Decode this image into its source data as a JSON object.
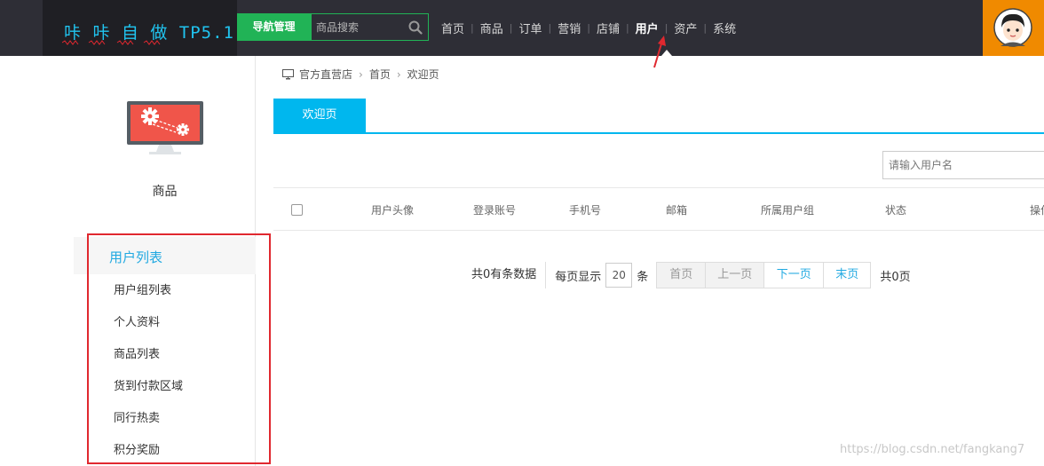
{
  "header": {
    "logo_text": "咔 咔 自 做 TP5.1",
    "nav_manage_label": "导航管理",
    "search_placeholder": "商品搜索",
    "menu": [
      {
        "label": "首页"
      },
      {
        "label": "商品"
      },
      {
        "label": "订单"
      },
      {
        "label": "营销"
      },
      {
        "label": "店铺"
      },
      {
        "label": "用户",
        "active": true
      },
      {
        "label": "资产"
      },
      {
        "label": "系统"
      }
    ],
    "avatar_bg": "#f08a00"
  },
  "sidebar": {
    "icon": "monitor-gears-icon",
    "category": "商品",
    "group_label": "用户列表",
    "items": [
      "用户组列表",
      "个人资料",
      "商品列表",
      "货到付款区域",
      "同行热卖",
      "积分奖励"
    ]
  },
  "breadcrumb": {
    "icon": "monitor-icon",
    "items": [
      "官方直营店",
      "首页",
      "欢迎页"
    ]
  },
  "tabs": {
    "active": "欢迎页"
  },
  "filter": {
    "placeholder": "请输入用户名"
  },
  "table": {
    "columns": [
      "用户头像",
      "登录账号",
      "手机号",
      "邮箱",
      "所属用户组",
      "状态",
      "操作"
    ]
  },
  "pager": {
    "total_text": "共0有条数据",
    "per_page_label": "每页显示",
    "page_size": "20",
    "unit": "条",
    "first": "首页",
    "prev": "上一页",
    "next": "下一页",
    "last": "末页",
    "pages_text": "共0页"
  },
  "watermark": "https://blog.csdn.net/fangkang7",
  "colors": {
    "accent": "#00b7ee",
    "nav_green": "#21b356",
    "link": "#21a9e1",
    "annotation_red": "#e0282f"
  }
}
